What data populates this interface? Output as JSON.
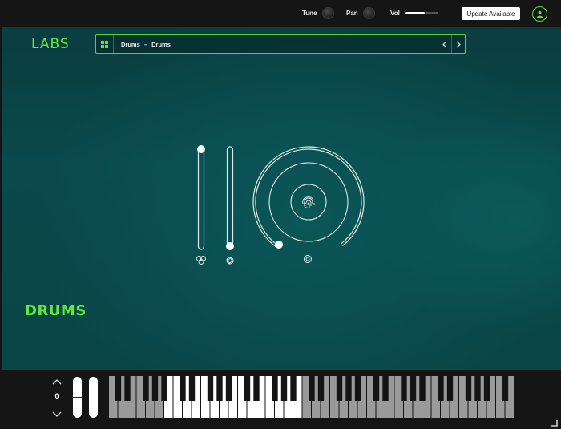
{
  "topbar": {
    "tune_label": "Tune",
    "pan_label": "Pan",
    "vol_label": "Vol",
    "vol_level": 0.6,
    "update_label": "Update Available"
  },
  "header": {
    "logo": "LABS",
    "preset": {
      "category": "Drums",
      "separator": "–",
      "name": "Drums"
    }
  },
  "instrument": {
    "name": "DRUMS"
  },
  "controls": {
    "slider1": {
      "level": 1.0,
      "icon": "three-circles-icon"
    },
    "slider2": {
      "level": 0.0,
      "icon": "aperture-icon"
    },
    "dial": {
      "icon": "fingerprint-icon",
      "sub_icon": "target-circle-icon"
    }
  },
  "keyboard": {
    "octave": "0",
    "total_white_keys": 44,
    "highlight_white_start": 6,
    "highlight_white_end": 20
  },
  "colors": {
    "accent": "#5ae63a",
    "background": "#151515",
    "panel": "#0a4a4c"
  }
}
